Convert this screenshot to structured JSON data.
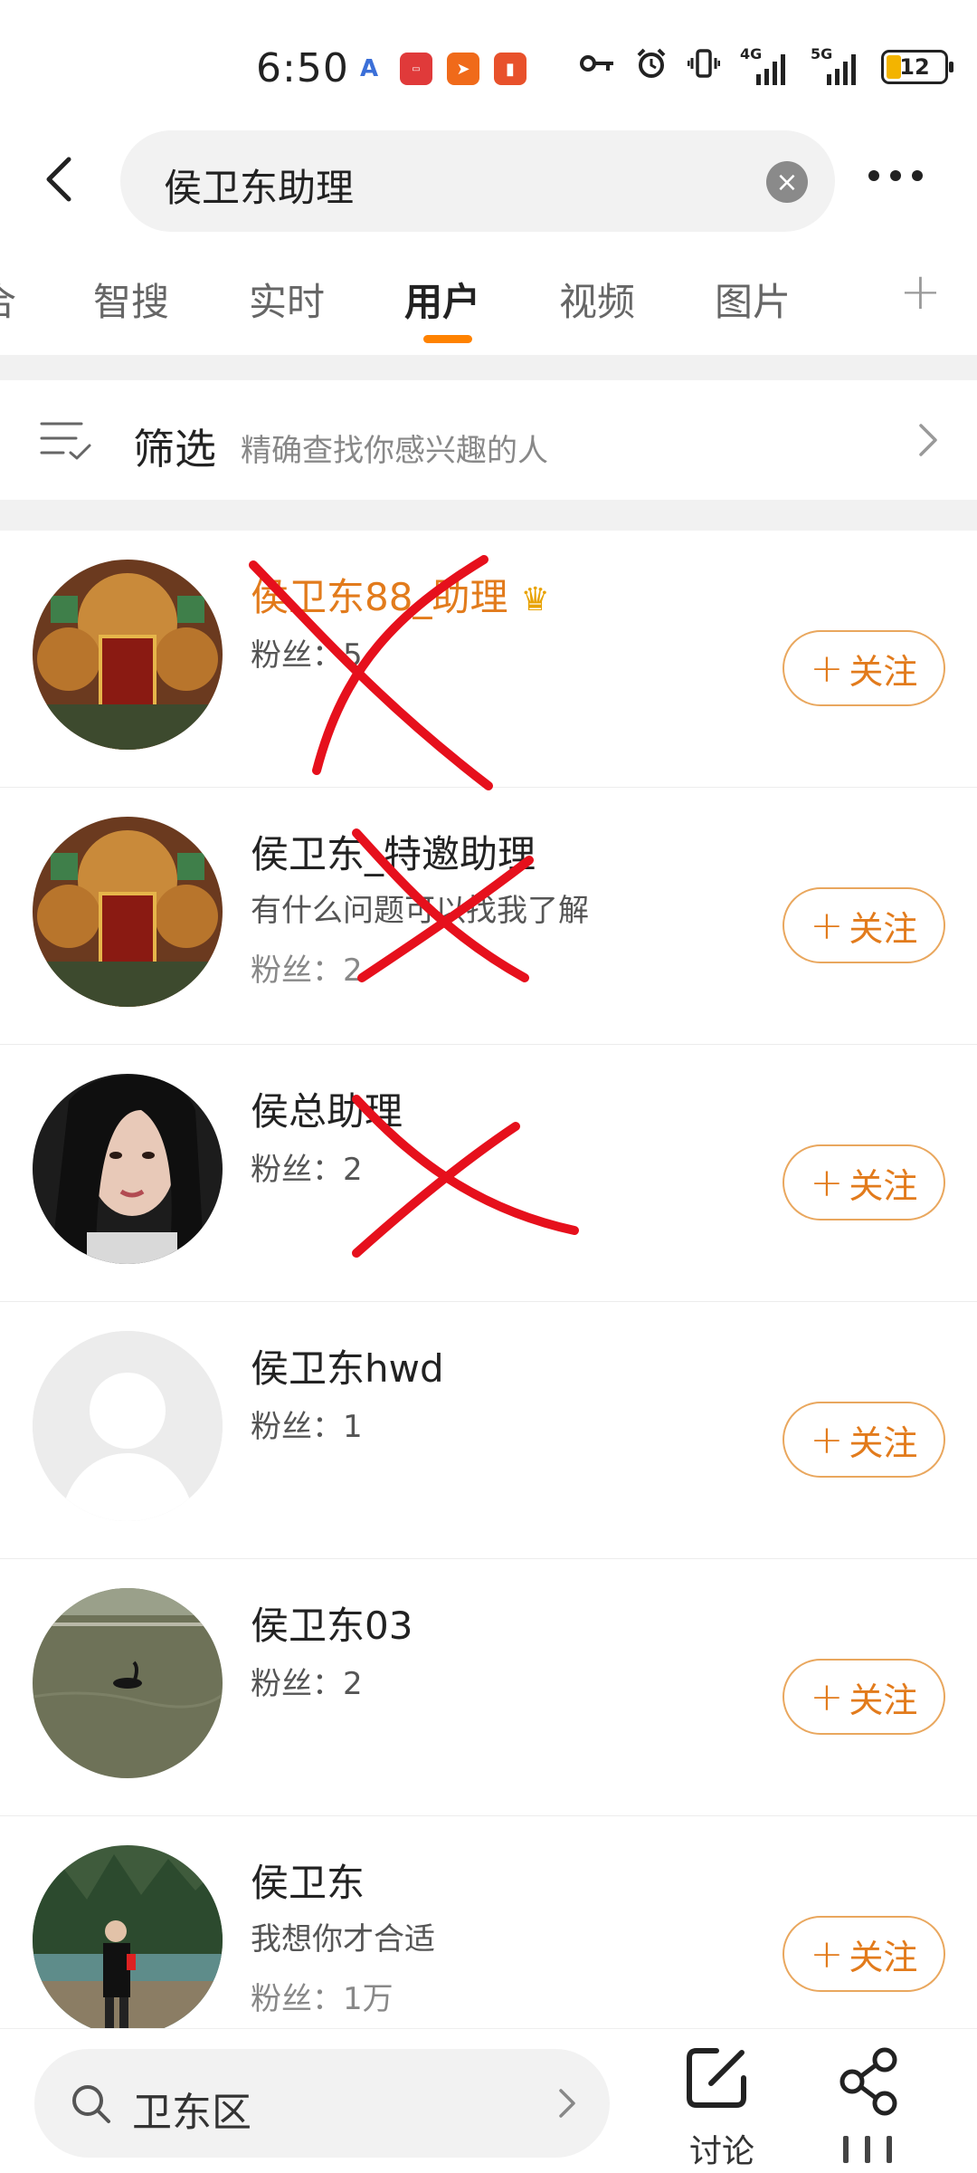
{
  "status_bar": {
    "time": "6:50",
    "battery": "12",
    "network_1": "4G",
    "network_2": "5G",
    "app_icons": [
      "a-app-icon",
      "huawei-store-icon",
      "weibo-notify-icon",
      "red-app-icon"
    ]
  },
  "header": {
    "search_query": "侯卫东助理"
  },
  "tabs": [
    {
      "label": "合"
    },
    {
      "label": "智搜"
    },
    {
      "label": "实时"
    },
    {
      "label": "用户",
      "active": true
    },
    {
      "label": "视频"
    },
    {
      "label": "图片"
    }
  ],
  "filter": {
    "title": "筛选",
    "subtitle": "精确查找你感兴趣的人"
  },
  "users": [
    {
      "name": "侯卫东88_助理",
      "line2": "粉丝：5",
      "follow": "关注",
      "highlighted": true,
      "crossed_out": true
    },
    {
      "name": "侯卫东_特邀助理",
      "line2": "有什么问题可以找我了解",
      "line3": "粉丝：2",
      "follow": "关注",
      "crossed_out": true
    },
    {
      "name": "侯总助理",
      "line2": "粉丝：2",
      "follow": "关注",
      "crossed_out": true
    },
    {
      "name": "侯卫东hwd",
      "line2": "粉丝：1",
      "follow": "关注"
    },
    {
      "name": "侯卫东03",
      "line2": "粉丝：2",
      "follow": "关注"
    },
    {
      "name": "侯卫东",
      "line2": "我想你才合适",
      "line3": "粉丝：1万",
      "follow": "关注"
    }
  ],
  "bottom_bar": {
    "search_text": "卫东区",
    "discuss_label": "讨论"
  },
  "colors": {
    "accent": "#ff8200",
    "follow_text": "#e27b1c",
    "cross_mark": "#e6101c"
  }
}
